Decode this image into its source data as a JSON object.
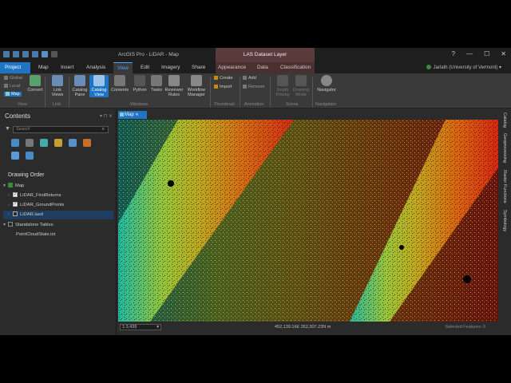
{
  "window": {
    "title": "ArcGIS Pro - LiDAR - Map",
    "context_header": "LAS Dataset Layer",
    "help": "?",
    "minimize": "—",
    "maximize": "☐",
    "close": "✕"
  },
  "tabs": {
    "project": "Project",
    "map": "Map",
    "insert": "Insert",
    "analysis": "Analysis",
    "view": "View",
    "edit": "Edit",
    "imagery": "Imagery",
    "share": "Share",
    "appearance": "Appearance",
    "data": "Data",
    "classification": "Classification"
  },
  "user": "Jarlath (University of Vermont) ▾",
  "ribbon": {
    "global": "Global",
    "local": "Local",
    "map": "Map",
    "convert": "Convert",
    "link_views": "Link Views",
    "catalog_pane": "Catalog Pane",
    "catalog_view": "Catalog View",
    "contents": "Contents",
    "python": "Python",
    "tasks": "Tasks",
    "reviewer_rules": "Reviewer Rules",
    "workflow_manager": "Workflow Manager",
    "create": "Create",
    "import": "Import",
    "add": "Add",
    "remove": "Remove",
    "depth_priority": "Depth Priority",
    "drawing_mode": "Drawing Mode",
    "navigator": "Navigator",
    "groups": {
      "view": "View",
      "link": "Link",
      "windows": "Windows",
      "thumbnail": "Thumbnail",
      "animation": "Animation",
      "scene": "Scene",
      "navigation": "Navigation"
    }
  },
  "contents": {
    "title": "Contents",
    "search_placeholder": "Search",
    "drawing_order": "Drawing Order",
    "map": "Map",
    "layers": [
      "LiDAR_FirstReturns",
      "LiDAR_GroundPoints",
      "LiDAR.lasd"
    ],
    "standalone_tables": "Standalone Tables",
    "table": "PointCloudStats.txt"
  },
  "map_tab": "Map",
  "status": {
    "scale": "1:3,439",
    "coords": "452,139.16E 262,307.23N m",
    "selected": "Selected Features: 0"
  },
  "side_panels": [
    "Catalog",
    "Geoprocessing",
    "Raster Functions",
    "Symbology"
  ],
  "colors": {
    "accent": "#1f74c4",
    "context": "#5a3a3a"
  }
}
